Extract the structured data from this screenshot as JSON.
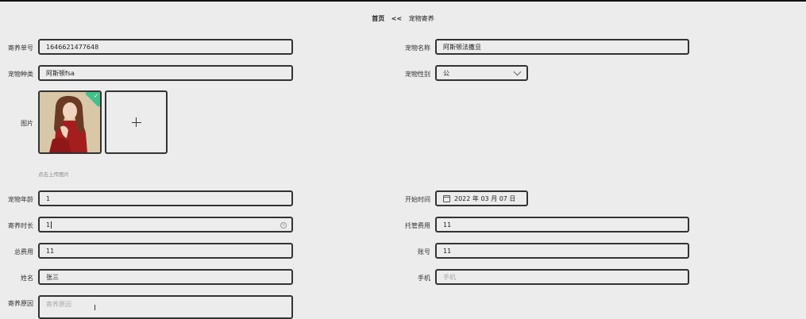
{
  "breadcrumb": {
    "home": "首页",
    "separator": "<<",
    "current": "宠物寄养"
  },
  "form": {
    "order_no_label": "寄养单号",
    "order_no_value": "1646621477648",
    "pet_name_label": "宠物名称",
    "pet_name_value": "阿斯顿法撒旦",
    "pet_type_label": "宠物种类",
    "pet_type_value": "阿斯顿fsa",
    "pet_gender_label": "宠物性别",
    "pet_gender_value": "公",
    "image_label": "图片",
    "upload_hint": "点击上传图片",
    "pet_age_label": "宠物年龄",
    "pet_age_value": "1",
    "start_time_label": "开始时间",
    "start_time_value": "2022 年 03 月 07 日",
    "duration_label": "寄养时长",
    "duration_value": "1",
    "care_fee_label": "托管费用",
    "care_fee_value": "11",
    "total_fee_label": "总费用",
    "total_fee_value": "11",
    "account_label": "账号",
    "account_value": "11",
    "name_label": "姓名",
    "name_value": "张三",
    "phone_label": "手机",
    "phone_placeholder": "手机",
    "reason_label": "寄养原因",
    "reason_placeholder": "寄养原因"
  },
  "icons": {
    "check": "checkmark-icon",
    "plus": "plus-icon",
    "calendar": "calendar-icon",
    "clear": "clear-circle-icon",
    "chevron": "chevron-down-icon"
  },
  "colors": {
    "success": "#45c08a"
  }
}
